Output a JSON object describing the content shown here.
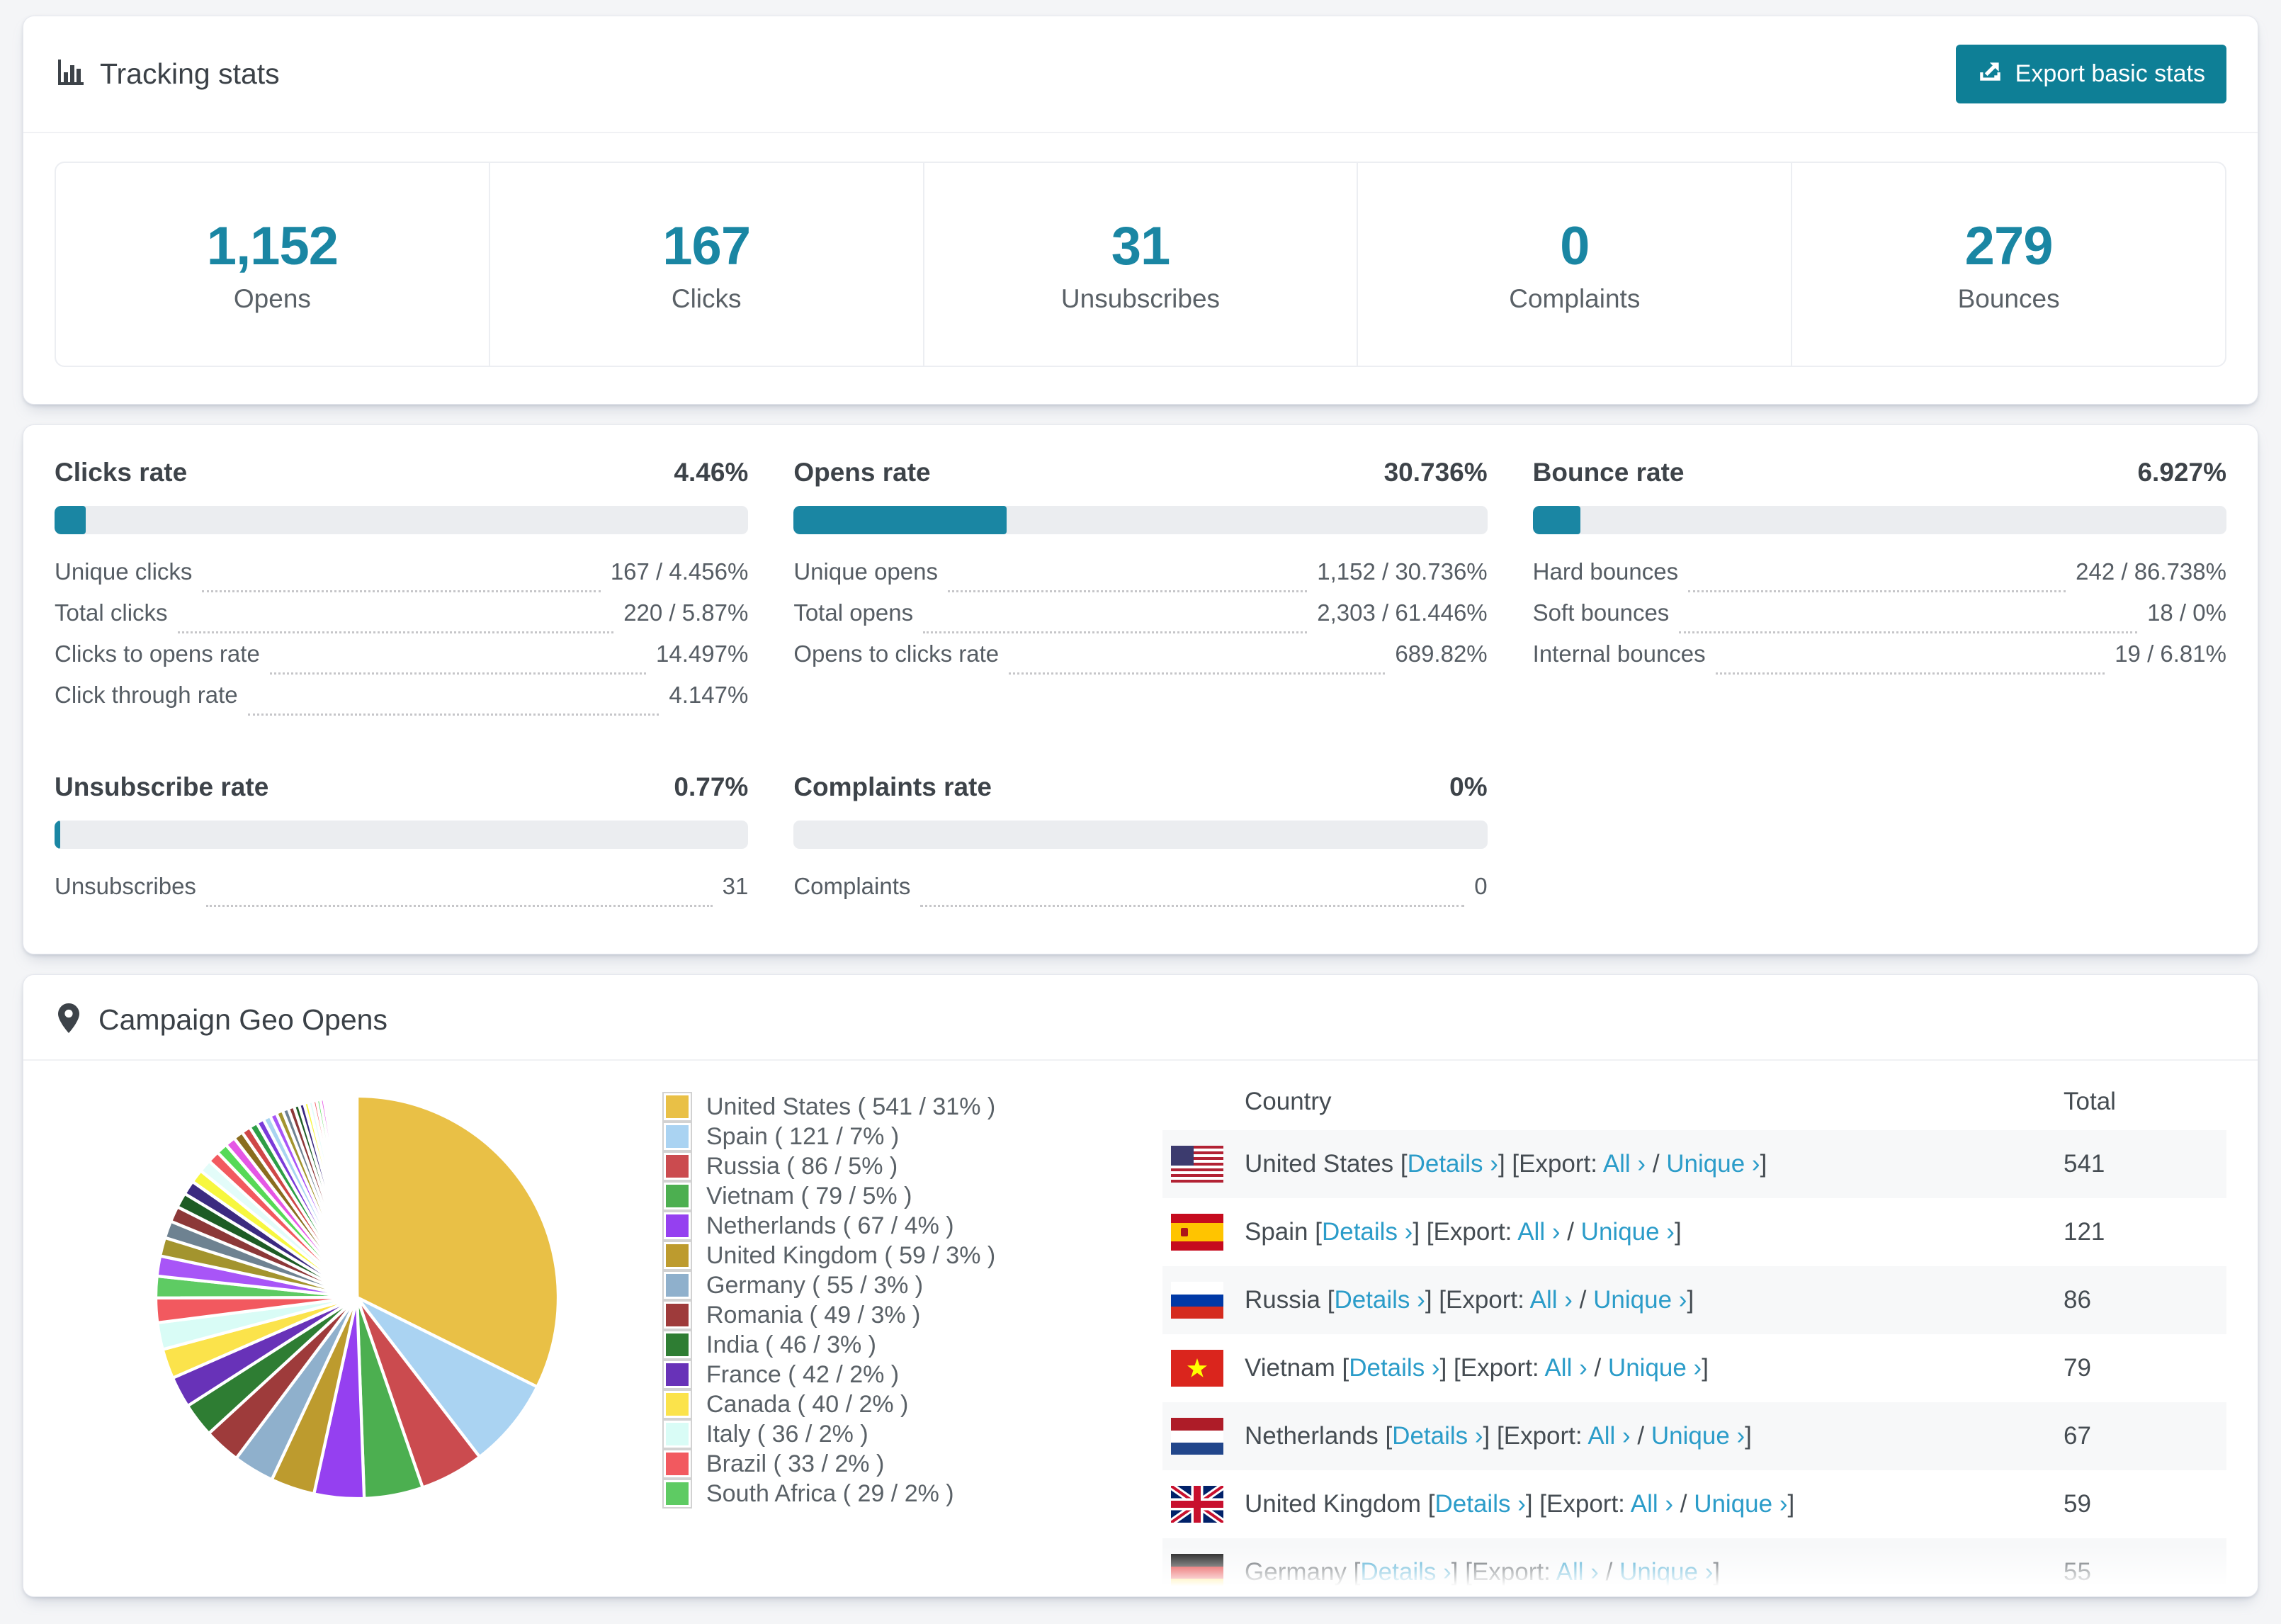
{
  "accent_color": "#1a86a3",
  "button_color": "#0e7f96",
  "link_color": "#2b9cc9",
  "header": {
    "title": "Tracking stats",
    "export_label": "Export basic stats"
  },
  "stats": [
    {
      "value": "1,152",
      "label": "Opens"
    },
    {
      "value": "167",
      "label": "Clicks"
    },
    {
      "value": "31",
      "label": "Unsubscribes"
    },
    {
      "value": "0",
      "label": "Complaints"
    },
    {
      "value": "279",
      "label": "Bounces"
    }
  ],
  "rates": [
    {
      "title": "Clicks rate",
      "value": "4.46%",
      "pct": 4.46,
      "rows": [
        [
          "Unique clicks",
          "167 / 4.456%"
        ],
        [
          "Total clicks",
          "220 / 5.87%"
        ],
        [
          "Clicks to opens rate",
          "14.497%"
        ],
        [
          "Click through rate",
          "4.147%"
        ]
      ]
    },
    {
      "title": "Opens rate",
      "value": "30.736%",
      "pct": 30.736,
      "rows": [
        [
          "Unique opens",
          "1,152 / 30.736%"
        ],
        [
          "Total opens",
          "2,303 / 61.446%"
        ],
        [
          "Opens to clicks rate",
          "689.82%"
        ]
      ]
    },
    {
      "title": "Bounce rate",
      "value": "6.927%",
      "pct": 6.927,
      "rows": [
        [
          "Hard bounces",
          "242 / 86.738%"
        ],
        [
          "Soft bounces",
          "18 / 0%"
        ],
        [
          "Internal bounces",
          "19 / 6.81%"
        ]
      ]
    },
    {
      "title": "Unsubscribe rate",
      "value": "0.77%",
      "pct": 0.77,
      "rows": [
        [
          "Unsubscribes",
          "31"
        ]
      ]
    },
    {
      "title": "Complaints rate",
      "value": "0%",
      "pct": 0,
      "rows": [
        [
          "Complaints",
          "0"
        ]
      ]
    }
  ],
  "geo": {
    "title": "Campaign Geo Opens",
    "headers": {
      "country": "Country",
      "total": "Total"
    },
    "links": {
      "details": "Details ›",
      "export_prefix": "Export:",
      "all": "All ›",
      "unique": "Unique ›"
    },
    "table_rows": [
      {
        "name": "United States",
        "flag": "us",
        "total": "541"
      },
      {
        "name": "Spain",
        "flag": "es",
        "total": "121"
      },
      {
        "name": "Russia",
        "flag": "ru",
        "total": "86"
      },
      {
        "name": "Vietnam",
        "flag": "vn",
        "total": "79"
      },
      {
        "name": "Netherlands",
        "flag": "nl",
        "total": "67"
      },
      {
        "name": "United Kingdom",
        "flag": "gb",
        "total": "59"
      },
      {
        "name": "Germany",
        "flag": "de",
        "total": "55"
      }
    ]
  },
  "chart_data": {
    "type": "pie",
    "title": "Campaign Geo Opens",
    "labels": [
      "United States",
      "Spain",
      "Russia",
      "Vietnam",
      "Netherlands",
      "United Kingdom",
      "Germany",
      "Romania",
      "India",
      "France",
      "Canada",
      "Italy",
      "Brazil",
      "South Africa"
    ],
    "values": [
      541,
      121,
      86,
      79,
      67,
      59,
      55,
      49,
      46,
      42,
      40,
      36,
      33,
      29
    ],
    "pcts": [
      "31%",
      "7%",
      "5%",
      "5%",
      "4%",
      "3%",
      "3%",
      "3%",
      "3%",
      "2%",
      "2%",
      "2%",
      "2%",
      "2%"
    ],
    "colors": [
      "#e9c046",
      "#aad3f2",
      "#cb4b4f",
      "#4caf50",
      "#9540f0",
      "#bd9b2e",
      "#8fb0cc",
      "#9e3b3b",
      "#2e7d33",
      "#6832b8",
      "#fbe34b",
      "#d9fcf6",
      "#f2595f",
      "#5ecb63"
    ],
    "legend_position": "right",
    "start_angle_deg": -90,
    "direction": "clockwise",
    "other_values": [
      27,
      25,
      23,
      21,
      20,
      19,
      18,
      17,
      16,
      15,
      14,
      13,
      12,
      11,
      10,
      10,
      9,
      9,
      8,
      8,
      7,
      7,
      6,
      6,
      5,
      5,
      5,
      4,
      4,
      4,
      3,
      3,
      3,
      3,
      2,
      2,
      2,
      2,
      2,
      2,
      1,
      1,
      1,
      1,
      1,
      1,
      1,
      1
    ],
    "other_palette": [
      "#a855f7",
      "#a3942e",
      "#6e8291",
      "#8c3838",
      "#1d5c24",
      "#3b2a80",
      "#f7f73f",
      "#e3fcf9",
      "#f2595f",
      "#57d957",
      "#e557e5",
      "#8a6d1f",
      "#cf4747",
      "#2e9e46",
      "#7a3bd9",
      "#a8d4f0"
    ]
  }
}
